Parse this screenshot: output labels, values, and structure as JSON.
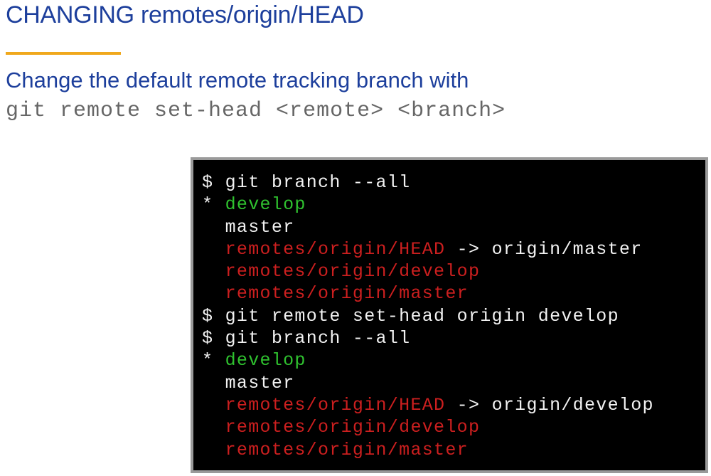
{
  "slide": {
    "title": "CHANGING remotes/origin/HEAD",
    "subtitle": "Change the default remote tracking branch with",
    "command": "git remote set-head <remote> <branch>",
    "accent_color": "#f0a81c",
    "title_color": "#1d3f9c"
  },
  "terminal": {
    "lines": [
      {
        "segments": [
          {
            "text": "$ git branch --all",
            "color": "white"
          }
        ]
      },
      {
        "segments": [
          {
            "text": "* ",
            "color": "white"
          },
          {
            "text": "develop",
            "color": "green"
          }
        ]
      },
      {
        "segments": [
          {
            "text": "  master",
            "color": "white"
          }
        ]
      },
      {
        "segments": [
          {
            "text": "  ",
            "color": "white"
          },
          {
            "text": "remotes/origin/HEAD",
            "color": "red"
          },
          {
            "text": " -> origin/master",
            "color": "white"
          }
        ]
      },
      {
        "segments": [
          {
            "text": "  ",
            "color": "white"
          },
          {
            "text": "remotes/origin/develop",
            "color": "red"
          }
        ]
      },
      {
        "segments": [
          {
            "text": "  ",
            "color": "white"
          },
          {
            "text": "remotes/origin/master",
            "color": "red"
          }
        ]
      },
      {
        "segments": [
          {
            "text": "$ git remote set-head origin develop",
            "color": "white"
          }
        ]
      },
      {
        "segments": [
          {
            "text": "$ git branch --all",
            "color": "white"
          }
        ]
      },
      {
        "segments": [
          {
            "text": "* ",
            "color": "white"
          },
          {
            "text": "develop",
            "color": "green"
          }
        ]
      },
      {
        "segments": [
          {
            "text": "  master",
            "color": "white"
          }
        ]
      },
      {
        "segments": [
          {
            "text": "  ",
            "color": "white"
          },
          {
            "text": "remotes/origin/HEAD",
            "color": "red"
          },
          {
            "text": " -> origin/develop",
            "color": "white"
          }
        ]
      },
      {
        "segments": [
          {
            "text": "  ",
            "color": "white"
          },
          {
            "text": "remotes/origin/develop",
            "color": "red"
          }
        ]
      },
      {
        "segments": [
          {
            "text": "  ",
            "color": "white"
          },
          {
            "text": "remotes/origin/master",
            "color": "red"
          }
        ]
      }
    ]
  }
}
